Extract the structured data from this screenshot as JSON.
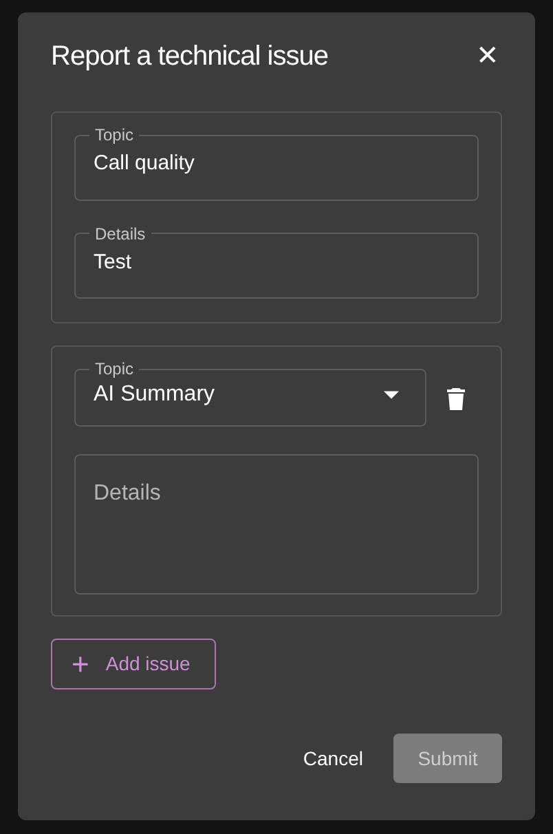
{
  "dialog": {
    "title": "Report a technical issue",
    "close": "✕"
  },
  "issues": [
    {
      "kind": "saved",
      "topic": {
        "label": "Topic",
        "value": "Call quality"
      },
      "details": {
        "label": "Details",
        "value": "Test"
      }
    },
    {
      "kind": "editing",
      "topic": {
        "label": "Topic",
        "value": "AI Summary"
      },
      "details": {
        "placeholder": "Details"
      }
    }
  ],
  "add_button": {
    "label": "Add issue",
    "icon": "+"
  },
  "actions": {
    "cancel": "Cancel",
    "submit": {
      "label": "Submit",
      "disabled": true
    }
  }
}
